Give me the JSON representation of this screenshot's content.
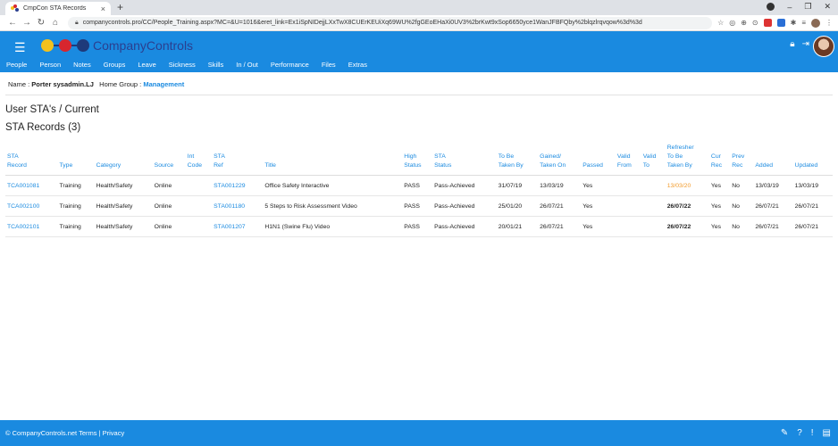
{
  "browser": {
    "tab_title": "CmpCon STA Records",
    "new_tab": "+",
    "url": "companycontrols.pro/CC/People_Training.aspx?MC=&U=1016&eret_link=Ex1iSpNIDejjLXxTwX8CUErKEUiXq69WU%2fgGEoEHaXi0UV3%2brKwt9xSop6650yce1WanJFBFQby%2blqzlrqvqow%3d%3d"
  },
  "app": {
    "brand": "CompanyControls",
    "menu": [
      "People",
      "Person",
      "Notes",
      "Groups",
      "Leave",
      "Sickness",
      "Skills",
      "In / Out",
      "Performance",
      "Files",
      "Extras"
    ]
  },
  "person": {
    "name_label": "Name :",
    "name_value": "Porter sysadmin.LJ",
    "group_label": "Home Group :",
    "group_value": "Management"
  },
  "page": {
    "heading": "User STA's / Current",
    "subheading": "STA Records (3)"
  },
  "table": {
    "headers": [
      [
        "STA",
        "Record"
      ],
      [
        "Type"
      ],
      [
        "Category"
      ],
      [
        "Source"
      ],
      [
        "Int",
        "Code"
      ],
      [
        "STA",
        "Ref"
      ],
      [
        "Title"
      ],
      [
        "High",
        "Status"
      ],
      [
        "STA",
        "Status"
      ],
      [
        "To Be",
        "Taken By"
      ],
      [
        "Gained/",
        "Taken On"
      ],
      [
        "Passed"
      ],
      [
        "Valid",
        "From"
      ],
      [
        "Valid",
        "To"
      ],
      [
        "Refresher",
        "To Be",
        "Taken By"
      ],
      [
        "Cur",
        "Rec"
      ],
      [
        "Prev",
        "Rec"
      ],
      [
        "Added"
      ],
      [
        "Updated"
      ]
    ],
    "rows": [
      [
        "TCA001081",
        "Training",
        "Health/Safety",
        "Online",
        "",
        "STA001229",
        "Office Safety Interactive",
        "PASS",
        "Pass-Achieved",
        "31/07/19",
        "13/03/19",
        "Yes",
        "",
        "",
        "13/03/20",
        "Yes",
        "No",
        "13/03/19",
        "13/03/19"
      ],
      [
        "TCA002100",
        "Training",
        "Health/Safety",
        "Online",
        "",
        "STA001180",
        "5 Steps to Risk Assessment Video",
        "PASS",
        "Pass-Achieved",
        "25/01/20",
        "26/07/21",
        "Yes",
        "",
        "",
        "26/07/22",
        "Yes",
        "No",
        "26/07/21",
        "26/07/21"
      ],
      [
        "TCA002101",
        "Training",
        "Health/Safety",
        "Online",
        "",
        "STA001207",
        "H1N1 (Swine Flu) Video",
        "PASS",
        "Pass-Achieved",
        "20/01/21",
        "26/07/21",
        "Yes",
        "",
        "",
        "26/07/22",
        "Yes",
        "No",
        "26/07/21",
        "26/07/21"
      ]
    ],
    "refresher_overdue_row": 0
  },
  "footer": {
    "text": "© CompanyControls.net Terms | Privacy"
  },
  "colors": {
    "primary": "#1a8ae0",
    "overdue": "#f29b2b",
    "brand_text": "#2b3f8f"
  }
}
